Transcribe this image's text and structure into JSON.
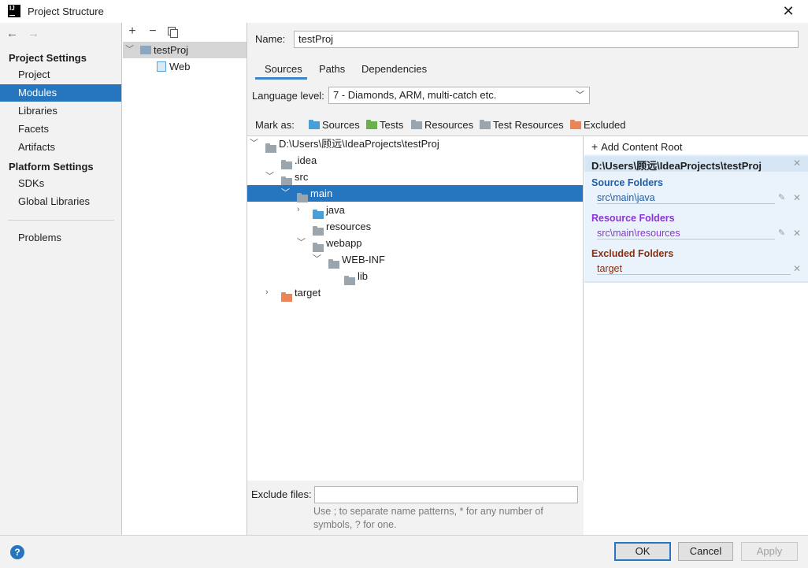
{
  "window": {
    "title": "Project Structure",
    "close_label": "✕"
  },
  "nav": {
    "back": "←",
    "forward": "→",
    "project_settings": "Project Settings",
    "project_items": [
      "Project",
      "Modules",
      "Libraries",
      "Facets",
      "Artifacts"
    ],
    "platform_settings": "Platform Settings",
    "platform_items": [
      "SDKs",
      "Global Libraries"
    ],
    "problems": "Problems",
    "selected": "Modules"
  },
  "modules": {
    "add": "+",
    "remove": "−",
    "items": [
      {
        "label": "testProj"
      },
      {
        "label": "Web"
      }
    ]
  },
  "editor": {
    "name_label": "Name:",
    "name_value": "testProj",
    "tabs": [
      "Sources",
      "Paths",
      "Dependencies"
    ],
    "language_label": "Language level:",
    "language_value": "7 - Diamonds, ARM, multi-catch etc.",
    "mark_as_label": "Mark as:",
    "mark_as": [
      "Sources",
      "Tests",
      "Resources",
      "Test Resources",
      "Excluded"
    ]
  },
  "tree": [
    {
      "label": "D:\\Users\\顾远\\IdeaProjects\\testProj",
      "expanded": true
    },
    {
      "label": ".idea"
    },
    {
      "label": "src",
      "expanded": true
    },
    {
      "label": "main",
      "expanded": true,
      "selected": true
    },
    {
      "label": "java",
      "expanded": false
    },
    {
      "label": "resources"
    },
    {
      "label": "webapp",
      "expanded": true
    },
    {
      "label": "WEB-INF",
      "expanded": true
    },
    {
      "label": "lib"
    },
    {
      "label": "target",
      "expanded": false
    }
  ],
  "roots": {
    "add_label": "Add Content Root",
    "path": "D:\\Users\\顾远\\IdeaProjects\\testProj",
    "source_title": "Source Folders",
    "source_path": "src\\main\\java",
    "resource_title": "Resource Folders",
    "resource_path": "src\\main\\resources",
    "excluded_title": "Excluded Folders",
    "excluded_path": "target"
  },
  "exclude": {
    "label": "Exclude files:",
    "value": "",
    "hint": "Use ; to separate name patterns, * for any number of symbols, ? for one."
  },
  "buttons": {
    "help": "?",
    "ok": "OK",
    "cancel": "Cancel",
    "apply": "Apply"
  },
  "colors": {
    "selection": "#2675bf",
    "sources": "#4a9fd6",
    "tests": "#6ab04c",
    "excluded": "#e8865a",
    "source_title": "#1f5ea8",
    "resource_title": "#8a34d6",
    "excluded_title": "#8b2e0e"
  }
}
